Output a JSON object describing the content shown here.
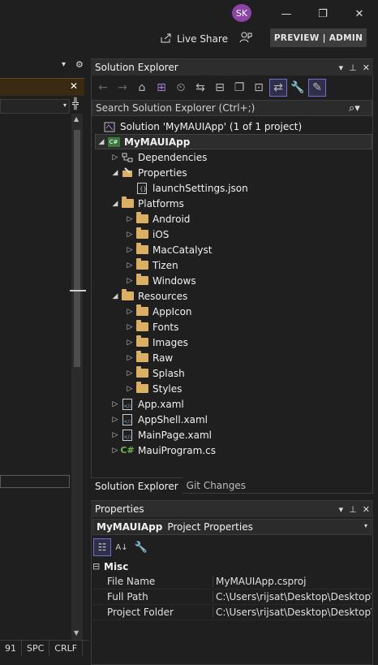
{
  "titlebar": {
    "avatar_initials": "SK",
    "minimize_glyph": "—",
    "restore_glyph": "❐",
    "close_glyph": "✕",
    "live_share_label": "Live Share",
    "preview_admin_label": "PREVIEW | ADMIN"
  },
  "left_pane": {
    "pin_glyph": "▾",
    "gear_glyph": "⚙",
    "close_glyph": "✕",
    "split_glyph": "╬",
    "status": [
      "91",
      "SPC",
      "CRLF"
    ]
  },
  "solution_explorer": {
    "title": "Solution Explorer",
    "search_placeholder": "Search Solution Explorer (Ctrl+;)",
    "solution_label": "Solution 'MyMAUIApp' (1 of 1 project)",
    "tree": [
      {
        "label": "MyMAUIApp",
        "level": 0,
        "expand": "◢",
        "icon": "csproj-icon",
        "selected": true
      },
      {
        "label": "Dependencies",
        "level": 1,
        "expand": "▷",
        "icon": "dependencies-icon"
      },
      {
        "label": "Properties",
        "level": 1,
        "expand": "◢",
        "icon": "properties-icon"
      },
      {
        "label": "launchSettings.json",
        "level": 2,
        "expand": "",
        "icon": "json-file-icon"
      },
      {
        "label": "Platforms",
        "level": 1,
        "expand": "◢",
        "icon": "folder-icon"
      },
      {
        "label": "Android",
        "level": 2,
        "expand": "▷",
        "icon": "folder-icon"
      },
      {
        "label": "iOS",
        "level": 2,
        "expand": "▷",
        "icon": "folder-icon"
      },
      {
        "label": "MacCatalyst",
        "level": 2,
        "expand": "▷",
        "icon": "folder-icon"
      },
      {
        "label": "Tizen",
        "level": 2,
        "expand": "▷",
        "icon": "folder-icon"
      },
      {
        "label": "Windows",
        "level": 2,
        "expand": "▷",
        "icon": "folder-icon"
      },
      {
        "label": "Resources",
        "level": 1,
        "expand": "◢",
        "icon": "folder-icon"
      },
      {
        "label": "AppIcon",
        "level": 2,
        "expand": "▷",
        "icon": "folder-icon"
      },
      {
        "label": "Fonts",
        "level": 2,
        "expand": "▷",
        "icon": "folder-icon"
      },
      {
        "label": "Images",
        "level": 2,
        "expand": "▷",
        "icon": "folder-icon"
      },
      {
        "label": "Raw",
        "level": 2,
        "expand": "▷",
        "icon": "folder-icon"
      },
      {
        "label": "Splash",
        "level": 2,
        "expand": "▷",
        "icon": "folder-icon"
      },
      {
        "label": "Styles",
        "level": 2,
        "expand": "▷",
        "icon": "folder-icon"
      },
      {
        "label": "App.xaml",
        "level": 1,
        "expand": "▷",
        "icon": "xaml-file-icon"
      },
      {
        "label": "AppShell.xaml",
        "level": 1,
        "expand": "▷",
        "icon": "xaml-file-icon"
      },
      {
        "label": "MainPage.xaml",
        "level": 1,
        "expand": "▷",
        "icon": "xaml-file-icon"
      },
      {
        "label": "MauiProgram.cs",
        "level": 1,
        "expand": "▷",
        "icon": "csharp-file-icon"
      }
    ],
    "tabs": [
      "Solution Explorer",
      "Git Changes"
    ]
  },
  "properties": {
    "title": "Properties",
    "object_name": "MyMAUIApp",
    "object_type": "Project Properties",
    "category": "Misc",
    "rows": [
      {
        "name": "File Name",
        "value": "MyMAUIApp.csproj"
      },
      {
        "name": "Full Path",
        "value": "C:\\Users\\rijsat\\Desktop\\Desktop\\Firs"
      },
      {
        "name": "Project Folder",
        "value": "C:\\Users\\rijsat\\Desktop\\Desktop\\Firs"
      }
    ]
  },
  "colors": {
    "background": "#1f1f1f",
    "panel_title": "#2d2d2d",
    "folder": "#dcb062",
    "avatar": "#8a44a6",
    "active_tool": "#6f6fd0"
  }
}
